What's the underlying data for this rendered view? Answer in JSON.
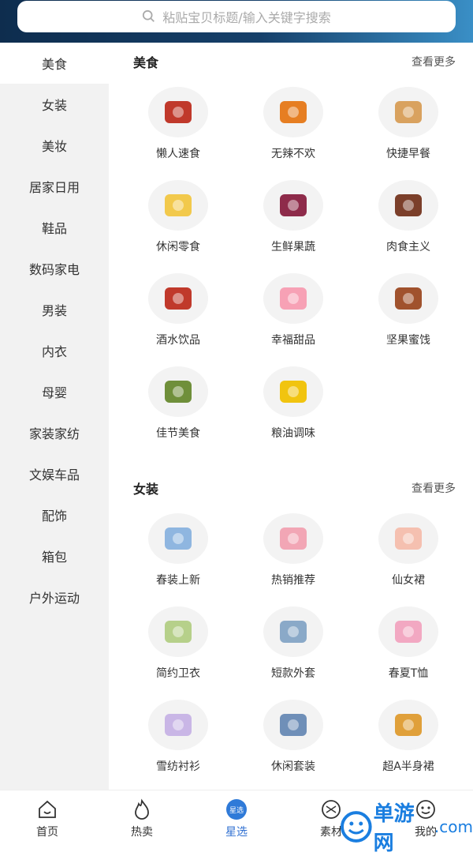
{
  "search": {
    "placeholder": "粘贴宝贝标题/输入关键字搜索"
  },
  "sidebar": {
    "items": [
      {
        "label": "美食",
        "active": true
      },
      {
        "label": "女装"
      },
      {
        "label": "美妆"
      },
      {
        "label": "居家日用"
      },
      {
        "label": "鞋品"
      },
      {
        "label": "数码家电"
      },
      {
        "label": "男装"
      },
      {
        "label": "内衣"
      },
      {
        "label": "母婴"
      },
      {
        "label": "家装家纺"
      },
      {
        "label": "文娱车品"
      },
      {
        "label": "配饰"
      },
      {
        "label": "箱包"
      },
      {
        "label": "户外运动"
      }
    ]
  },
  "sections": [
    {
      "title": "美食",
      "more": "查看更多",
      "items": [
        {
          "label": "懒人速食",
          "icon": "instant-noodle-icon",
          "color": "#c0392b"
        },
        {
          "label": "无辣不欢",
          "icon": "spicy-snack-icon",
          "color": "#e67e22"
        },
        {
          "label": "快捷早餐",
          "icon": "bread-icon",
          "color": "#d9a25f"
        },
        {
          "label": "休闲零食",
          "icon": "chips-bag-icon",
          "color": "#f2c94c"
        },
        {
          "label": "生鲜果蔬",
          "icon": "berries-icon",
          "color": "#8e2b4a"
        },
        {
          "label": "肉食主义",
          "icon": "beef-jerky-icon",
          "color": "#7b3f2a"
        },
        {
          "label": "酒水饮品",
          "icon": "drinks-icon",
          "color": "#c0392b"
        },
        {
          "label": "幸福甜品",
          "icon": "macaron-icon",
          "color": "#f7a1b5"
        },
        {
          "label": "坚果蜜饯",
          "icon": "nuts-icon",
          "color": "#a0522d"
        },
        {
          "label": "佳节美食",
          "icon": "dumpling-icon",
          "color": "#6f8f3a"
        },
        {
          "label": "粮油调味",
          "icon": "oil-rice-icon",
          "color": "#f1c40f"
        }
      ]
    },
    {
      "title": "女装",
      "more": "查看更多",
      "items": [
        {
          "label": "春装上新",
          "icon": "blouse-icon",
          "color": "#8fb6e0"
        },
        {
          "label": "热销推荐",
          "icon": "skirt-outfit-icon",
          "color": "#f2a6b5"
        },
        {
          "label": "仙女裙",
          "icon": "dress-icon",
          "color": "#f5c0b0"
        },
        {
          "label": "简约卫衣",
          "icon": "hoodie-icon",
          "color": "#b6d08a"
        },
        {
          "label": "短款外套",
          "icon": "denim-jacket-icon",
          "color": "#8aa9c8"
        },
        {
          "label": "春夏T恤",
          "icon": "tshirt-icon",
          "color": "#f2a8c2"
        },
        {
          "label": "雪纺衬衫",
          "icon": "chiffon-shirt-icon",
          "color": "#c9b6e6"
        },
        {
          "label": "休闲套装",
          "icon": "casual-set-icon",
          "color": "#6f8fb8"
        },
        {
          "label": "超A半身裙",
          "icon": "a-line-skirt-icon",
          "color": "#e0a03a"
        }
      ]
    }
  ],
  "tabs": [
    {
      "label": "首页",
      "icon": "home-icon"
    },
    {
      "label": "热卖",
      "icon": "flame-icon"
    },
    {
      "label": "星选",
      "icon": "star-select-icon",
      "badge": "星选",
      "active": true
    },
    {
      "label": "素材",
      "icon": "material-icon"
    },
    {
      "label": "我的",
      "icon": "profile-icon"
    }
  ],
  "watermark": {
    "brand": "单游网",
    "domain": ".com"
  }
}
